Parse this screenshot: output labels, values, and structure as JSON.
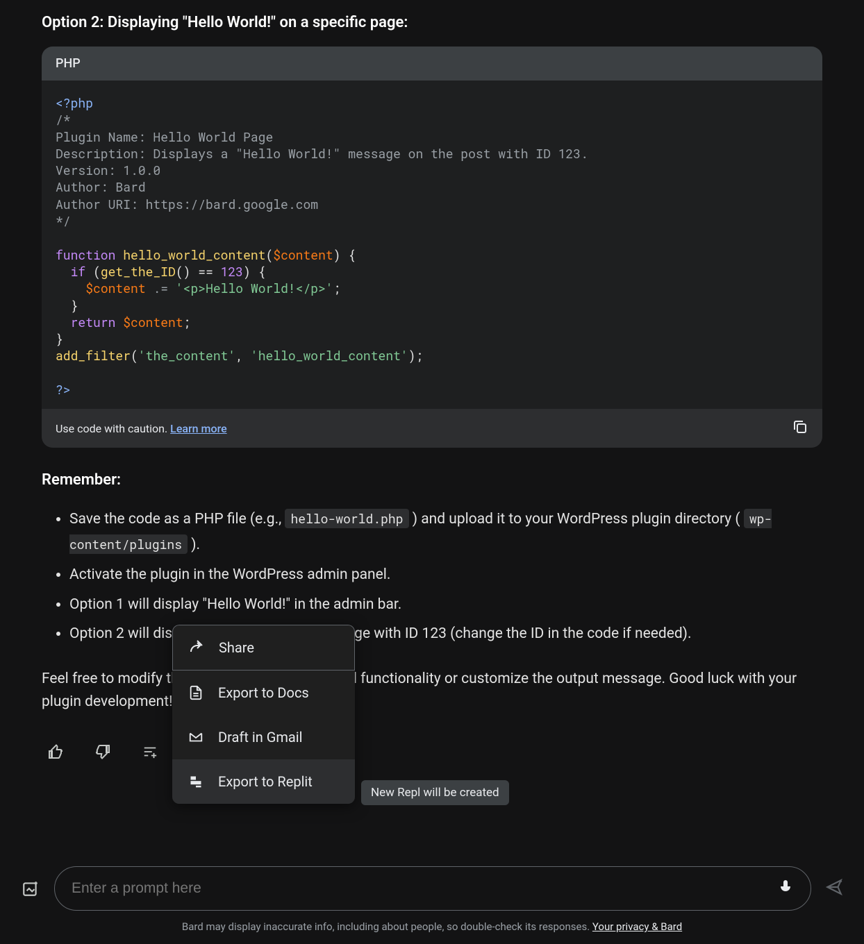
{
  "option": {
    "title": "Option 2: Displaying \"Hello World!\" on a specific page:"
  },
  "code": {
    "lang": "PHP",
    "caution": "Use code with caution.",
    "learn": "Learn more",
    "tokens": {
      "open": "<?php",
      "c1": "/*",
      "c2": "Plugin Name: Hello World Page",
      "c3": "Description: Displays a \"Hello World!\" message on the post with ID 123.",
      "c4": "Version: 1.0.0",
      "c5": "Author: Bard",
      "c6": "Author URI: https://bard.google.com",
      "c7": "*/",
      "kw_function": "function",
      "fn_name": "hello_world_content",
      "var_content": "$content",
      "kw_if": "if",
      "fn_getid": "get_the_ID",
      "num_id": "123",
      "concat": ".=",
      "str_hello": "'<p>Hello World!</p>'",
      "kw_return": "return",
      "fn_addfilter": "add_filter",
      "str_hook": "'the_content'",
      "str_cb": "'hello_world_content'",
      "close": "?>"
    }
  },
  "remember": {
    "title": "Remember:",
    "items": {
      "p1a": "Save the code as a PHP file (e.g., ",
      "p1code1": "hello-world.php",
      "p1b": " ) and upload it to your WordPress plugin directory ( ",
      "p1code2": "wp-content/plugins",
      "p1c": " ).",
      "p2": "Activate the plugin in the WordPress admin panel.",
      "p3": "Option 1 will display \"Hello World!\" in the admin bar.",
      "p4": "Option 2 will display \"Hello World!\" on the page with ID 123 (change the ID in the code if needed)."
    }
  },
  "closing": "Feel free to modify the code to include additional functionality or customize the output message. Good luck with your plugin development!",
  "popup": {
    "items": {
      "share": "Share",
      "docs": "Export to Docs",
      "gmail": "Draft in Gmail",
      "replit": "Export to Replit"
    }
  },
  "tooltip": "New Repl will be created",
  "input": {
    "placeholder": "Enter a prompt here"
  },
  "disclaimer": {
    "text": "Bard may display inaccurate info, including about people, so double-check its responses. ",
    "link": "Your privacy & Bard"
  }
}
